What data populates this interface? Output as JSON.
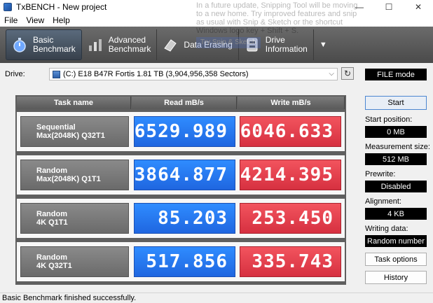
{
  "window": {
    "title": "TxBENCH - New project",
    "controls": [
      "—",
      "☐",
      "✕"
    ]
  },
  "menu": [
    "File",
    "View",
    "Help"
  ],
  "notification": {
    "text": "In a future update, Snipping Tool will be moving to a new home. Try improved features and snip as usual with Snip & Sketch or the shortcut Windows logo key + Shift + S.",
    "button": "Try Snip & Sketch"
  },
  "toolbar": {
    "tabs": [
      {
        "label": "Basic\nBenchmark",
        "icon": "stopwatch-icon"
      },
      {
        "label": "Advanced\nBenchmark",
        "icon": "bar-chart-icon"
      },
      {
        "label": "Data Erasing",
        "icon": "eraser-icon"
      },
      {
        "label": "Drive\nInformation",
        "icon": "drive-info-icon"
      }
    ],
    "more": "▼"
  },
  "drive": {
    "label": "Drive:",
    "selected": "(C:) E18 B47R Fortis  1.81 TB (3,904,956,358 Sectors)",
    "mode": "FILE mode"
  },
  "table": {
    "headers": [
      "Task name",
      "Read mB/s",
      "Write mB/s"
    ],
    "rows": [
      {
        "task": "Sequential\nMax(2048K) Q32T1",
        "read": "6529.989",
        "write": "6046.633"
      },
      {
        "task": "Random\nMax(2048K) Q1T1",
        "read": "3864.877",
        "write": "4214.395"
      },
      {
        "task": "Random\n4K Q1T1",
        "read": "85.203",
        "write": "253.450"
      },
      {
        "task": "Random\n4K Q32T1",
        "read": "517.856",
        "write": "335.743"
      }
    ]
  },
  "side": {
    "start": "Start",
    "start_position_label": "Start position:",
    "start_position": "0 MB",
    "measurement_size_label": "Measurement size:",
    "measurement_size": "512 MB",
    "prewrite_label": "Prewrite:",
    "prewrite": "Disabled",
    "alignment_label": "Alignment:",
    "alignment": "4 KB",
    "writing_data_label": "Writing data:",
    "writing_data": "Random number",
    "task_options": "Task options",
    "history": "History"
  },
  "status": "Basic Benchmark finished successfully.",
  "colors": {
    "read": "#2f8cff",
    "write": "#e8404c",
    "toolbar": "#555555"
  }
}
